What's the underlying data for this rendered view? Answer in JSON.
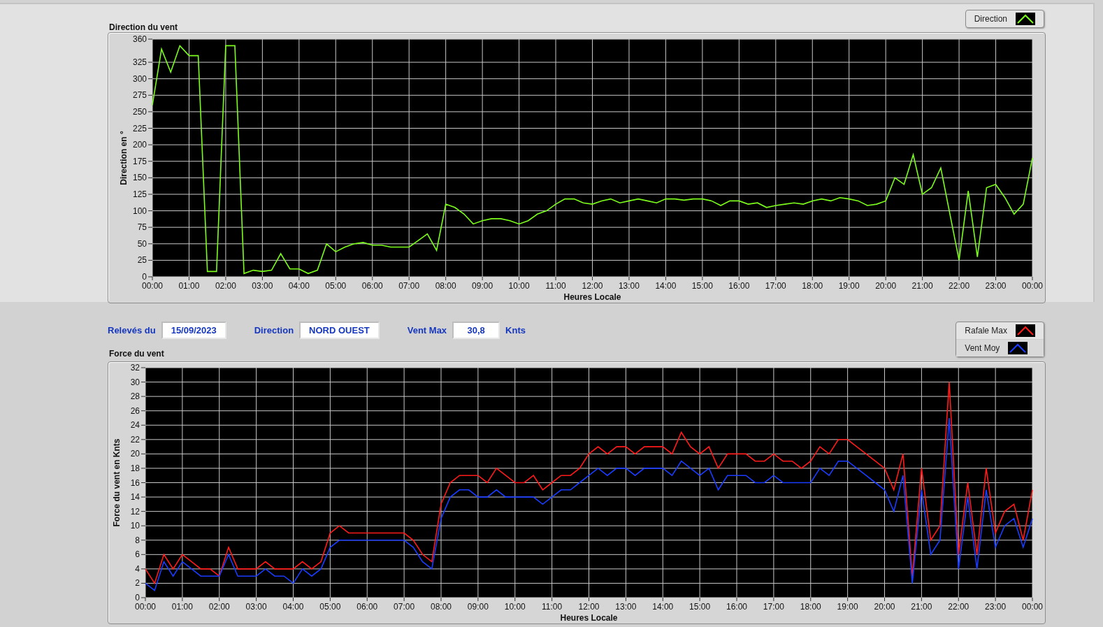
{
  "direction_chart": {
    "chart_data": {
      "type": "line",
      "grid": true,
      "title": "Direction du vent",
      "xlabel": "Heures Locale",
      "ylabel": "Direction en °",
      "xlim": [
        0,
        24
      ],
      "ylim": [
        0,
        360
      ],
      "x": [
        0,
        0.25,
        0.5,
        0.75,
        1,
        1.25,
        1.5,
        1.75,
        2,
        2.25,
        2.5,
        2.75,
        3,
        3.25,
        3.5,
        3.75,
        4,
        4.25,
        4.5,
        4.75,
        5,
        5.25,
        5.5,
        5.75,
        6,
        6.25,
        6.5,
        6.75,
        7,
        7.25,
        7.5,
        7.75,
        8,
        8.25,
        8.5,
        8.75,
        9,
        9.25,
        9.5,
        9.75,
        10,
        10.25,
        10.5,
        10.75,
        11,
        11.25,
        11.5,
        11.75,
        12,
        12.25,
        12.5,
        12.75,
        13,
        13.25,
        13.5,
        13.75,
        14,
        14.25,
        14.5,
        14.75,
        15,
        15.25,
        15.5,
        15.75,
        16,
        16.25,
        16.5,
        16.75,
        17,
        17.25,
        17.5,
        17.75,
        18,
        18.25,
        18.5,
        18.75,
        19,
        19.25,
        19.5,
        19.75,
        20,
        20.25,
        20.5,
        20.75,
        21,
        21.25,
        21.5,
        21.75,
        22,
        22.25,
        22.5,
        22.75,
        23,
        23.25,
        23.5,
        23.75,
        24
      ],
      "xticks": [
        {
          "value": 0,
          "label": "00:00"
        },
        {
          "value": 1,
          "label": "01:00"
        },
        {
          "value": 2,
          "label": "02:00"
        },
        {
          "value": 3,
          "label": "03:00"
        },
        {
          "value": 4,
          "label": "04:00"
        },
        {
          "value": 5,
          "label": "05:00"
        },
        {
          "value": 6,
          "label": "06:00"
        },
        {
          "value": 7,
          "label": "07:00"
        },
        {
          "value": 8,
          "label": "08:00"
        },
        {
          "value": 9,
          "label": "09:00"
        },
        {
          "value": 10,
          "label": "10:00"
        },
        {
          "value": 11,
          "label": "11:00"
        },
        {
          "value": 12,
          "label": "12:00"
        },
        {
          "value": 13,
          "label": "13:00"
        },
        {
          "value": 14,
          "label": "14:00"
        },
        {
          "value": 15,
          "label": "15:00"
        },
        {
          "value": 16,
          "label": "16:00"
        },
        {
          "value": 17,
          "label": "17:00"
        },
        {
          "value": 18,
          "label": "18:00"
        },
        {
          "value": 19,
          "label": "19:00"
        },
        {
          "value": 20,
          "label": "20:00"
        },
        {
          "value": 21,
          "label": "21:00"
        },
        {
          "value": 22,
          "label": "22:00"
        },
        {
          "value": 23,
          "label": "23:00"
        },
        {
          "value": 24,
          "label": "00:00"
        }
      ],
      "yticks": [
        0,
        25,
        50,
        75,
        100,
        125,
        150,
        175,
        200,
        225,
        250,
        275,
        300,
        325,
        360
      ],
      "series": [
        {
          "name": "Direction",
          "color": "#7cfc1c",
          "values": [
            260,
            345,
            310,
            350,
            335,
            335,
            8,
            8,
            350,
            350,
            5,
            10,
            8,
            10,
            35,
            12,
            12,
            5,
            10,
            50,
            38,
            45,
            50,
            52,
            48,
            48,
            45,
            45,
            45,
            55,
            65,
            40,
            110,
            105,
            95,
            80,
            85,
            88,
            88,
            85,
            80,
            85,
            95,
            100,
            110,
            118,
            118,
            112,
            110,
            115,
            118,
            112,
            115,
            118,
            115,
            112,
            118,
            118,
            116,
            118,
            118,
            115,
            108,
            115,
            115,
            110,
            112,
            105,
            108,
            110,
            112,
            110,
            115,
            118,
            115,
            120,
            118,
            115,
            108,
            110,
            115,
            150,
            140,
            185,
            125,
            135,
            165,
            95,
            25,
            130,
            30,
            135,
            140,
            120,
            95,
            110,
            180
          ]
        }
      ]
    }
  },
  "info_bar": {
    "fields": [
      {
        "label": "Relevés du",
        "value": "15/09/2023"
      },
      {
        "label": "Direction",
        "value": "NORD OUEST"
      },
      {
        "label": "Vent Max",
        "value": "30,8",
        "unit": "Knts"
      }
    ]
  },
  "force_chart": {
    "chart_data": {
      "type": "line",
      "grid": true,
      "title": "Force du vent",
      "xlabel": "Heures Locale",
      "ylabel": "Force du vent en Knts",
      "xlim": [
        0,
        24
      ],
      "ylim": [
        0,
        32
      ],
      "x": [
        0,
        0.25,
        0.5,
        0.75,
        1,
        1.25,
        1.5,
        1.75,
        2,
        2.25,
        2.5,
        2.75,
        3,
        3.25,
        3.5,
        3.75,
        4,
        4.25,
        4.5,
        4.75,
        5,
        5.25,
        5.5,
        5.75,
        6,
        6.25,
        6.5,
        6.75,
        7,
        7.25,
        7.5,
        7.75,
        8,
        8.25,
        8.5,
        8.75,
        9,
        9.25,
        9.5,
        9.75,
        10,
        10.25,
        10.5,
        10.75,
        11,
        11.25,
        11.5,
        11.75,
        12,
        12.25,
        12.5,
        12.75,
        13,
        13.25,
        13.5,
        13.75,
        14,
        14.25,
        14.5,
        14.75,
        15,
        15.25,
        15.5,
        15.75,
        16,
        16.25,
        16.5,
        16.75,
        17,
        17.25,
        17.5,
        17.75,
        18,
        18.25,
        18.5,
        18.75,
        19,
        19.25,
        19.5,
        19.75,
        20,
        20.25,
        20.5,
        20.75,
        21,
        21.25,
        21.5,
        21.75,
        22,
        22.25,
        22.5,
        22.75,
        23,
        23.25,
        23.5,
        23.75,
        24
      ],
      "xticks": [
        {
          "value": 0,
          "label": "00:00"
        },
        {
          "value": 1,
          "label": "01:00"
        },
        {
          "value": 2,
          "label": "02:00"
        },
        {
          "value": 3,
          "label": "03:00"
        },
        {
          "value": 4,
          "label": "04:00"
        },
        {
          "value": 5,
          "label": "05:00"
        },
        {
          "value": 6,
          "label": "06:00"
        },
        {
          "value": 7,
          "label": "07:00"
        },
        {
          "value": 8,
          "label": "08:00"
        },
        {
          "value": 9,
          "label": "09:00"
        },
        {
          "value": 10,
          "label": "10:00"
        },
        {
          "value": 11,
          "label": "11:00"
        },
        {
          "value": 12,
          "label": "12:00"
        },
        {
          "value": 13,
          "label": "13:00"
        },
        {
          "value": 14,
          "label": "14:00"
        },
        {
          "value": 15,
          "label": "15:00"
        },
        {
          "value": 16,
          "label": "16:00"
        },
        {
          "value": 17,
          "label": "17:00"
        },
        {
          "value": 18,
          "label": "18:00"
        },
        {
          "value": 19,
          "label": "19:00"
        },
        {
          "value": 20,
          "label": "20:00"
        },
        {
          "value": 21,
          "label": "21:00"
        },
        {
          "value": 22,
          "label": "22:00"
        },
        {
          "value": 23,
          "label": "23:00"
        },
        {
          "value": 24,
          "label": "00:00"
        }
      ],
      "yticks": [
        0,
        2,
        4,
        6,
        8,
        10,
        12,
        14,
        16,
        18,
        20,
        22,
        24,
        26,
        28,
        30,
        32
      ],
      "series": [
        {
          "name": "Rafale Max",
          "color": "#ff1a1a",
          "values": [
            4,
            2,
            6,
            4,
            6,
            5,
            4,
            4,
            3,
            7,
            4,
            4,
            4,
            5,
            4,
            4,
            4,
            5,
            4,
            5,
            9,
            10,
            9,
            9,
            9,
            9,
            9,
            9,
            9,
            8,
            6,
            5,
            13,
            16,
            17,
            17,
            17,
            16,
            18,
            17,
            16,
            16,
            17,
            15,
            16,
            17,
            17,
            18,
            20,
            21,
            20,
            21,
            21,
            20,
            21,
            21,
            21,
            20,
            23,
            21,
            20,
            21,
            18,
            20,
            20,
            20,
            19,
            19,
            20,
            19,
            19,
            18,
            19,
            21,
            20,
            22,
            22,
            21,
            20,
            19,
            18,
            15,
            20,
            3,
            18,
            8,
            10,
            30,
            6,
            16,
            6,
            18,
            9,
            12,
            13,
            8,
            15
          ]
        },
        {
          "name": "Vent Moy",
          "color": "#1a3cff",
          "values": [
            2,
            1,
            5,
            3,
            5,
            4,
            3,
            3,
            3,
            6,
            3,
            3,
            3,
            4,
            3,
            3,
            2,
            4,
            3,
            4,
            7,
            8,
            8,
            8,
            8,
            8,
            8,
            8,
            8,
            7,
            5,
            4,
            11,
            14,
            15,
            15,
            14,
            14,
            15,
            14,
            14,
            14,
            14,
            13,
            14,
            15,
            15,
            16,
            17,
            18,
            17,
            18,
            18,
            17,
            18,
            18,
            18,
            17,
            19,
            18,
            17,
            18,
            15,
            17,
            17,
            17,
            16,
            16,
            17,
            16,
            16,
            16,
            16,
            18,
            17,
            19,
            19,
            18,
            17,
            16,
            15,
            12,
            17,
            2,
            15,
            6,
            8,
            25,
            4,
            14,
            4,
            15,
            7,
            10,
            11,
            7,
            11
          ]
        }
      ]
    }
  }
}
